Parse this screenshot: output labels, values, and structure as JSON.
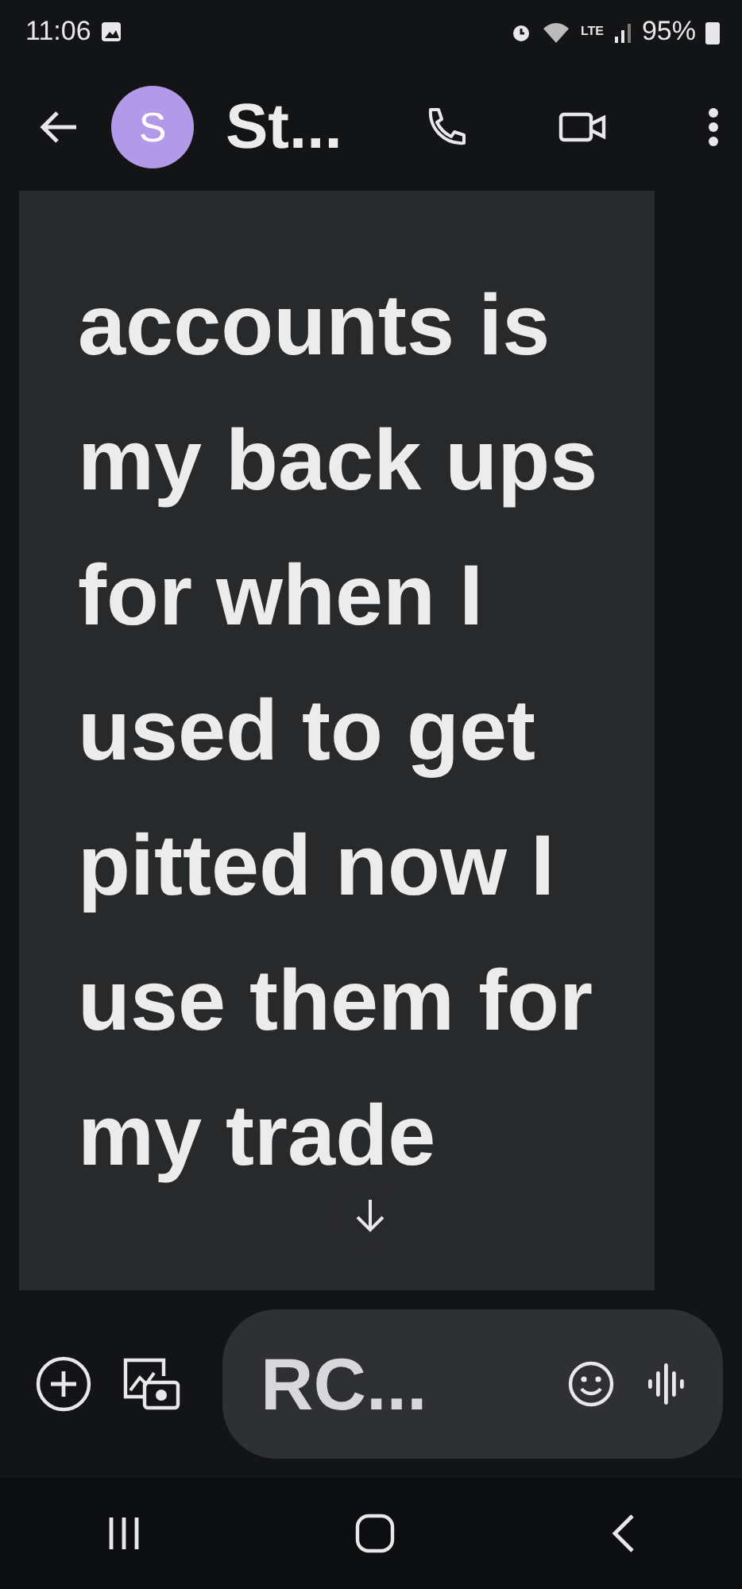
{
  "status_bar": {
    "time": "11:06",
    "network": "LTE",
    "battery": "95%"
  },
  "header": {
    "avatar_letter": "S",
    "contact_name": "St..."
  },
  "message": {
    "lines": [
      "accounts is",
      "my back ups",
      "for when I",
      "used to get",
      "pitted now I",
      "use them for",
      "my trade"
    ]
  },
  "composer": {
    "value": "RC..."
  }
}
